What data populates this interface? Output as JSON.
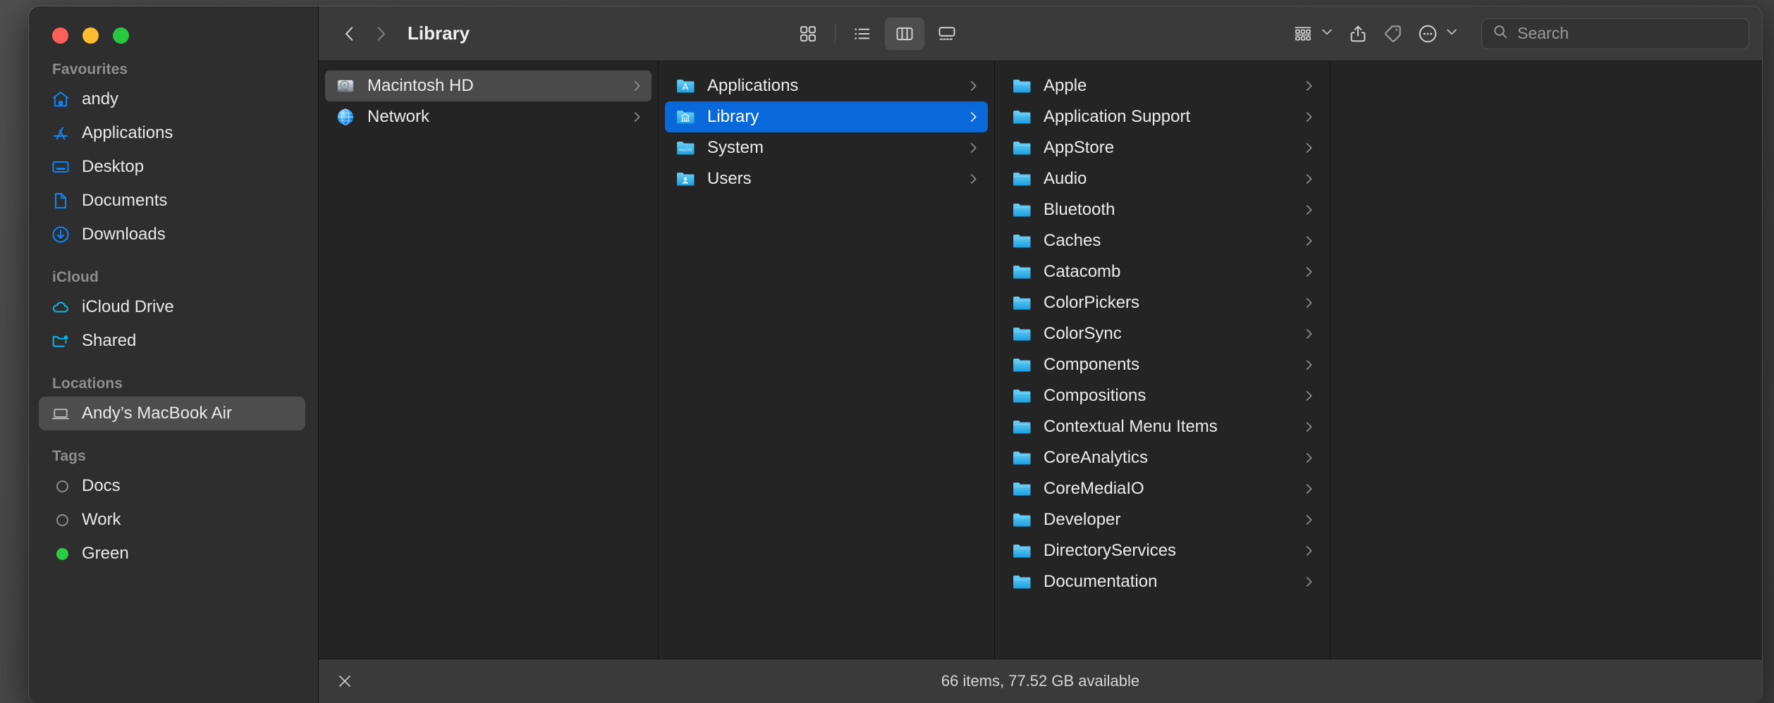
{
  "window": {
    "title": "Library",
    "traffic_lights": [
      {
        "name": "close",
        "color": "#ff5f57"
      },
      {
        "name": "minimize",
        "color": "#febc2e"
      },
      {
        "name": "zoom",
        "color": "#28c840"
      }
    ]
  },
  "toolbar": {
    "back_icon": "chevron-left-icon",
    "forward_icon": "chevron-right-icon",
    "title": "Library",
    "view_buttons": [
      {
        "name": "icon-view",
        "icon": "grid-icon",
        "active": false
      },
      {
        "name": "list-view",
        "icon": "list-icon",
        "active": false
      },
      {
        "name": "column-view",
        "icon": "columns-icon",
        "active": true
      },
      {
        "name": "gallery-view",
        "icon": "gallery-icon",
        "active": false
      }
    ],
    "group_button": {
      "name": "group-by",
      "icon": "group-icon"
    },
    "share_button": {
      "name": "share",
      "icon": "share-icon"
    },
    "tag_button": {
      "name": "add-tags",
      "icon": "tag-icon"
    },
    "more_button": {
      "name": "more-actions",
      "icon": "ellipsis-circle-icon"
    }
  },
  "search": {
    "placeholder": "Search",
    "value": "",
    "icon": "search-icon"
  },
  "sidebar": {
    "sections": [
      {
        "title": "Favourites",
        "items": [
          {
            "label": "andy",
            "icon": "home-icon",
            "color": "#0a84ff",
            "selected": false
          },
          {
            "label": "Applications",
            "icon": "appstore-icon",
            "color": "#0a84ff",
            "selected": false
          },
          {
            "label": "Desktop",
            "icon": "desktop-icon",
            "color": "#0a84ff",
            "selected": false
          },
          {
            "label": "Documents",
            "icon": "document-icon",
            "color": "#0a84ff",
            "selected": false
          },
          {
            "label": "Downloads",
            "icon": "download-icon",
            "color": "#0a84ff",
            "selected": false
          }
        ]
      },
      {
        "title": "iCloud",
        "items": [
          {
            "label": "iCloud Drive",
            "icon": "cloud-icon",
            "color": "#0ab4e8",
            "selected": false
          },
          {
            "label": "Shared",
            "icon": "shared-folder-icon",
            "color": "#0ab4e8",
            "selected": false
          }
        ]
      },
      {
        "title": "Locations",
        "items": [
          {
            "label": "Andy’s MacBook Air",
            "icon": "laptop-icon",
            "color": "#b4b4b4",
            "selected": true
          }
        ]
      },
      {
        "title": "Tags",
        "items": [
          {
            "label": "Docs",
            "icon": "tag-dot-icon",
            "color": "#8c8c8c",
            "filled": false,
            "selected": false
          },
          {
            "label": "Work",
            "icon": "tag-dot-icon",
            "color": "#8c8c8c",
            "filled": false,
            "selected": false
          },
          {
            "label": "Green",
            "icon": "tag-dot-icon",
            "color": "#27cd41",
            "filled": true,
            "selected": false
          }
        ]
      }
    ]
  },
  "columns": [
    {
      "name": "column-devices",
      "rows": [
        {
          "label": "Macintosh HD",
          "icon": "harddisk-icon",
          "chevron": true,
          "state": "selected-inactive"
        },
        {
          "label": "Network",
          "icon": "globe-icon",
          "chevron": true,
          "state": "normal"
        }
      ]
    },
    {
      "name": "column-macintosh-hd",
      "rows": [
        {
          "label": "Applications",
          "icon": "folder-apps-icon",
          "chevron": true,
          "state": "normal"
        },
        {
          "label": "Library",
          "icon": "folder-library-icon",
          "chevron": true,
          "state": "selected-active"
        },
        {
          "label": "System",
          "icon": "folder-system-icon",
          "chevron": true,
          "state": "normal"
        },
        {
          "label": "Users",
          "icon": "folder-users-icon",
          "chevron": true,
          "state": "normal"
        }
      ]
    },
    {
      "name": "column-library",
      "rows": [
        {
          "label": "Apple",
          "icon": "folder-icon",
          "chevron": true,
          "state": "normal"
        },
        {
          "label": "Application Support",
          "icon": "folder-icon",
          "chevron": true,
          "state": "normal"
        },
        {
          "label": "AppStore",
          "icon": "folder-icon",
          "chevron": true,
          "state": "normal"
        },
        {
          "label": "Audio",
          "icon": "folder-icon",
          "chevron": true,
          "state": "normal"
        },
        {
          "label": "Bluetooth",
          "icon": "folder-icon",
          "chevron": true,
          "state": "normal"
        },
        {
          "label": "Caches",
          "icon": "folder-icon",
          "chevron": true,
          "state": "normal"
        },
        {
          "label": "Catacomb",
          "icon": "folder-icon",
          "chevron": true,
          "state": "normal"
        },
        {
          "label": "ColorPickers",
          "icon": "folder-icon",
          "chevron": true,
          "state": "normal"
        },
        {
          "label": "ColorSync",
          "icon": "folder-icon",
          "chevron": true,
          "state": "normal"
        },
        {
          "label": "Components",
          "icon": "folder-icon",
          "chevron": true,
          "state": "normal"
        },
        {
          "label": "Compositions",
          "icon": "folder-icon",
          "chevron": true,
          "state": "normal"
        },
        {
          "label": "Contextual Menu Items",
          "icon": "folder-icon",
          "chevron": true,
          "state": "normal"
        },
        {
          "label": "CoreAnalytics",
          "icon": "folder-icon",
          "chevron": true,
          "state": "normal"
        },
        {
          "label": "CoreMediaIO",
          "icon": "folder-icon",
          "chevron": true,
          "state": "normal"
        },
        {
          "label": "Developer",
          "icon": "folder-icon",
          "chevron": true,
          "state": "normal"
        },
        {
          "label": "DirectoryServices",
          "icon": "folder-icon",
          "chevron": true,
          "state": "normal"
        },
        {
          "label": "Documentation",
          "icon": "folder-icon",
          "chevron": true,
          "state": "normal"
        }
      ]
    },
    {
      "name": "column-preview",
      "rows": []
    }
  ],
  "statusbar": {
    "close_icon": "x-icon",
    "text": "66 items, 77.52 GB available"
  },
  "colors": {
    "accent_blue": "#0a69da",
    "sidebar_icon_blue": "#0a84ff",
    "icloud_cyan": "#0ab4e8",
    "window_bg": "#242424",
    "sidebar_bg": "#2e2e2e",
    "toolbar_bg": "#3a3a3a",
    "tag_green": "#27cd41"
  }
}
